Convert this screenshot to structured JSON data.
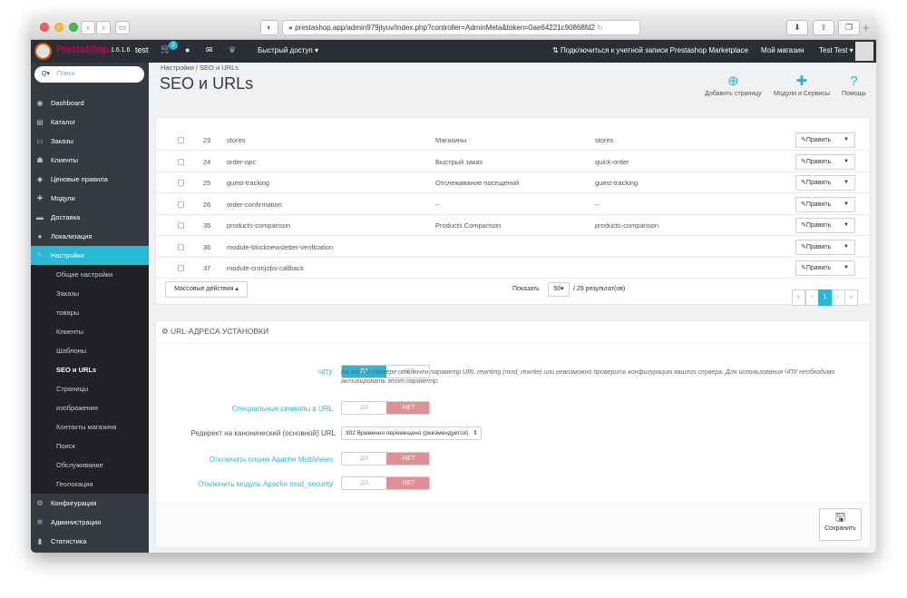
{
  "browser": {
    "url": "prestashop.app/admin979jtyuv/index.php?controller=AdminMeta&token=0ae64221c90868fd2"
  },
  "header": {
    "logo": "PrestaShop",
    "version": "1.6.1.6",
    "shop": "test",
    "cart_badge": "2",
    "quick_access": "Быстрый доступ",
    "marketplace": "Подключиться к учетной записи Prestashop Marketplace",
    "my_shop": "Мой магазин",
    "user": "Test Test"
  },
  "sidebar": {
    "search_placeholder": "Поиск",
    "items": [
      {
        "label": "Dashboard",
        "icon": "dashboard-icon"
      },
      {
        "label": "Каталог",
        "icon": "catalog-icon"
      },
      {
        "label": "Заказы",
        "icon": "orders-icon"
      },
      {
        "label": "Клиенты",
        "icon": "customers-icon"
      },
      {
        "label": "Ценовые правила",
        "icon": "price-rules-icon"
      },
      {
        "label": "Модули",
        "icon": "modules-icon"
      },
      {
        "label": "Доставка",
        "icon": "shipping-icon"
      },
      {
        "label": "Локализация",
        "icon": "localization-icon"
      },
      {
        "label": "Настройки",
        "icon": "wrench-icon"
      }
    ],
    "subitems": [
      "Общие настройки",
      "Заказы",
      "товары",
      "Клиенты",
      "Шаблоны",
      "SEO и URLs",
      "Страницы",
      "изображения",
      "Контакты магазина",
      "Поиск",
      "Обслуживание",
      "Геолокация"
    ],
    "bottom_items": [
      {
        "label": "Конфигурация",
        "icon": "config-icon"
      },
      {
        "label": "Администрация",
        "icon": "admin-icon"
      },
      {
        "label": "Статистика",
        "icon": "stats-icon"
      }
    ]
  },
  "page": {
    "breadcrumb_1": "Настройки",
    "breadcrumb_2": "SEO и URLs",
    "title": "SEO и URLs",
    "toolbar": {
      "add_page": "Добавить страницу",
      "modules": "Модули и Сервисы",
      "help": "Помощь"
    }
  },
  "table": {
    "edit_label": "Править",
    "rows": [
      {
        "id": "23",
        "page": "stores",
        "title": "Магазины",
        "url": "stores"
      },
      {
        "id": "24",
        "page": "order-opc",
        "title": "Быстрый заказ",
        "url": "quick-order"
      },
      {
        "id": "25",
        "page": "guest-tracking",
        "title": "Отслеживание посещений",
        "url": "guest-tracking"
      },
      {
        "id": "26",
        "page": "order-confirmation",
        "title": "--",
        "url": "--"
      },
      {
        "id": "35",
        "page": "products-comparison",
        "title": "Products Comparison",
        "url": "products-comparison"
      },
      {
        "id": "36",
        "page": "module-blocknewsletter-verification",
        "title": "",
        "url": ""
      },
      {
        "id": "37",
        "page": "module-cronjobs-callback",
        "title": "",
        "url": ""
      }
    ],
    "bulk_actions": "Массовые действия",
    "show_label": "Показать",
    "per_page": "50",
    "results": "/ 29 результат(ов)",
    "pages": [
      "«",
      "‹",
      "1",
      "›",
      "»"
    ]
  },
  "settings": {
    "heading": "URL-АДРЕСА УСТАНОВКИ",
    "friendly_url_label": "ЧПУ",
    "yes": "ДА",
    "no": "НЕТ",
    "hint": "На вашем сервере отключен параметр URL rewriting (mod_rewrite) или невозможно проверить конфигурацию вашего сервера. Для использования ЧПУ необходимо активировать этот параметр.",
    "special_chars_label": "Специальные символы в URL",
    "redirect_label": "Редирект на канонический (основной) URL",
    "redirect_value": "302 Временно перемещено (рекомендуется)",
    "multiviews_label": "Отключить опцию Apache MultiViews",
    "mod_security_label": "Отключить модуль Apache mod_security",
    "save": "Сохранить"
  }
}
